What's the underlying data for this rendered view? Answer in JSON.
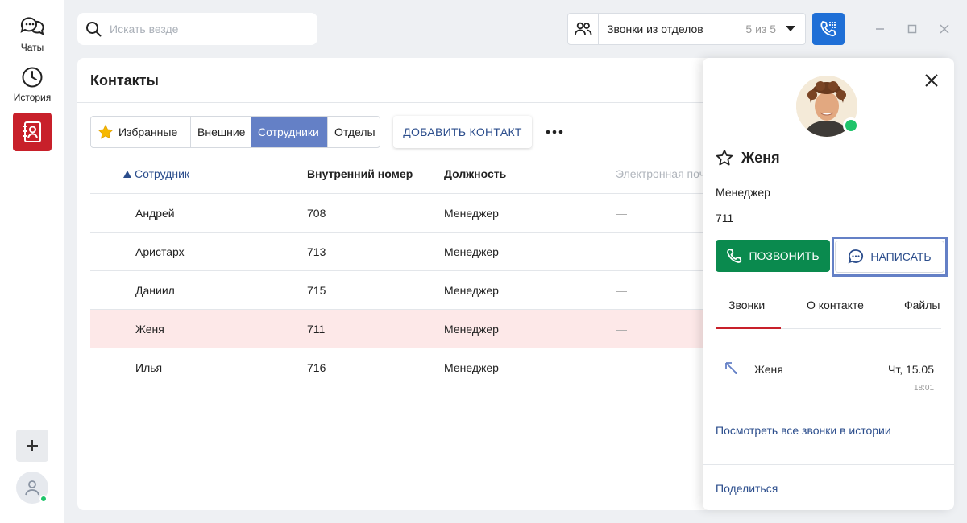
{
  "rail": {
    "chats_label": "Чаты",
    "history_label": "История"
  },
  "search": {
    "placeholder": "Искать везде"
  },
  "dept_filter": {
    "label": "Звонки из отделов",
    "count": "5 из 5"
  },
  "contacts": {
    "title": "Контакты",
    "tabs": {
      "favorites": "Избранные",
      "external": "Внешние",
      "employees": "Сотрудники",
      "departments": "Отделы"
    },
    "add_button": "ДОБАВИТЬ КОНТАКТ",
    "columns": {
      "employee": "Сотрудник",
      "ext": "Внутренний номер",
      "position": "Должность",
      "email": "Электронная почта"
    },
    "rows": [
      {
        "name": "Андрей",
        "ext": "708",
        "position": "Менеджер",
        "email": "—"
      },
      {
        "name": "Аристарх",
        "ext": "713",
        "position": "Менеджер",
        "email": "—"
      },
      {
        "name": "Даниил",
        "ext": "715",
        "position": "Менеджер",
        "email": "—"
      },
      {
        "name": "Женя",
        "ext": "711",
        "position": "Менеджер",
        "email": "—"
      },
      {
        "name": "Илья",
        "ext": "716",
        "position": "Менеджер",
        "email": "—"
      }
    ]
  },
  "card": {
    "name": "Женя",
    "position": "Менеджер",
    "ext": "711",
    "call_button": "ПОЗВОНИТЬ",
    "write_button": "НАПИСАТЬ",
    "tabs": {
      "calls": "Звонки",
      "about": "О контакте",
      "files": "Файлы"
    },
    "call_entry": {
      "name": "Женя",
      "date": "Чт, 15.05",
      "time": "18:01"
    },
    "history_link": "Посмотреть все звонки в истории",
    "share": "Поделиться"
  },
  "colors": {
    "accent": "#6480c6",
    "brand_red": "#c8202a",
    "call_green": "#0a8a4e",
    "selected_row": "#fde8e8"
  }
}
